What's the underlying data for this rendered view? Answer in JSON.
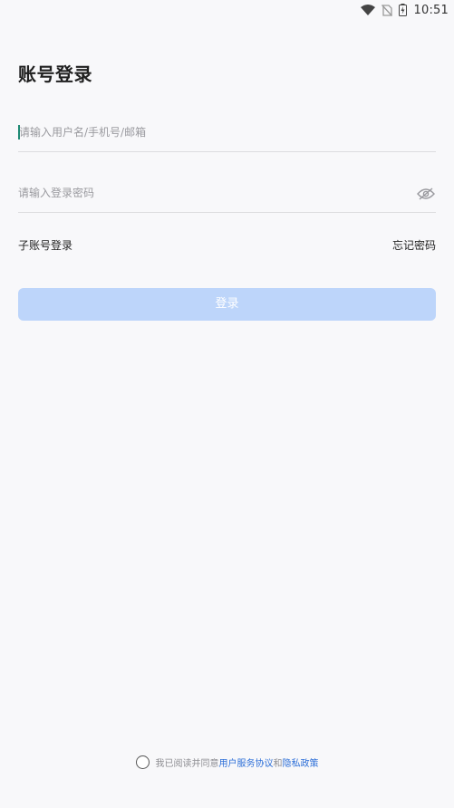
{
  "status_bar": {
    "time": "10:51",
    "icons": [
      "wifi-icon",
      "no-sim-icon",
      "battery-charging-icon"
    ]
  },
  "page": {
    "title": "账号登录"
  },
  "form": {
    "username_placeholder": "请输入用户名/手机号/邮箱",
    "password_placeholder": "请输入登录密码",
    "password_visibility_icon": "eye-off-icon",
    "sub_account_login": "子账号登录",
    "forgot_password": "忘记密码",
    "login_button": "登录"
  },
  "agreement": {
    "prefix": "我已阅读并同意 ",
    "terms_link": "用户服务协议",
    "conjunction": "和 ",
    "privacy_link": "隐私政策"
  },
  "colors": {
    "accent": "#2d6fd8",
    "button_disabled_bg": "#bdd5fa",
    "caret": "#1f8a74",
    "background": "#f8f8fa"
  }
}
